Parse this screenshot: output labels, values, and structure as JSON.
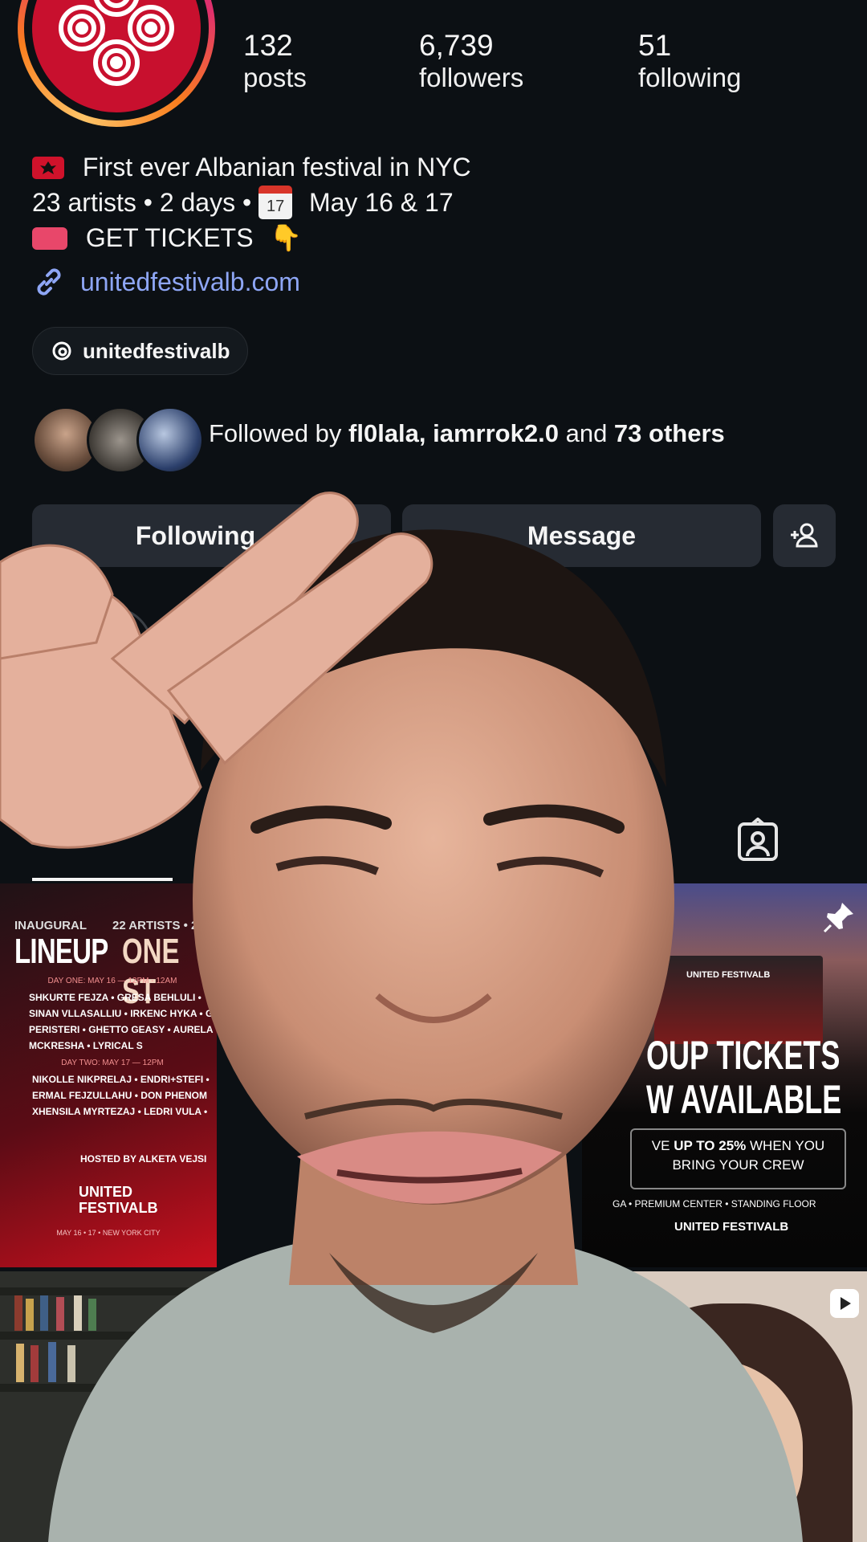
{
  "profile": {
    "stats": [
      {
        "value": "132",
        "label": "posts"
      },
      {
        "value": "6,739",
        "label": "followers"
      },
      {
        "value": "51",
        "label": "following"
      }
    ],
    "bio_line1": "First ever Albanian festival in NYC",
    "bio_line2_a": "23 artists • 2 days •",
    "calendar_emoji_day": "17",
    "bio_line2_b": "May 16 & 17",
    "bio_line3": "GET TICKETS",
    "pointing_emoji": "👇",
    "link": "unitedfestivalb.com",
    "threads_handle": "unitedfestivalb",
    "followed_by_prefix": "Followed by ",
    "followed_by_names": "fl0lala, iamrrok2.0",
    "followed_by_and": " and ",
    "followed_by_others": "73 others",
    "accent_color": "#c8102e",
    "link_color": "#8ea6f5"
  },
  "actions": {
    "following_label": "Following",
    "message_label": "Message"
  },
  "posts": {
    "lineup": {
      "title_left": "LINEUP",
      "title_right": "ONE ST",
      "inaugural": "INAUGURAL",
      "artists_count": "22 ARTISTS • 2",
      "day_one": "DAY ONE: MAY 16 — 12PM - 12AM",
      "day_one_lines": [
        "SHKURTE FEJZA • GRESA BEHLULI •",
        "SINAN VLLASALLIU • IRKENC HYKA • G",
        "PERISTERI • GHETTO GEASY • AURELA",
        "MCKRESHA • LYRICAL S"
      ],
      "day_two": "DAY TWO: MAY 17 — 12PM",
      "day_two_lines": [
        "NIKOLLE NIKPRELAJ • ENDRI+STEFI •",
        "ERMAL FEJZULLAHU • DON PHENOM",
        "XHENSILA MYRTEZAJ • LEDRI VULA •"
      ],
      "hosted_by": "HOSTED BY ALKETA VEJSI",
      "brand": "UNITED FESTIVALB",
      "footer": "MAY 16 • 17 • NEW YORK CITY"
    },
    "tickets": {
      "line1": "OUP TICKETS",
      "line2": "W AVAILABLE",
      "save_a": "VE ",
      "save_b": "UP TO 25%",
      "save_c": " WHEN YOU",
      "save_d": "BRING YOUR CREW",
      "tiers": "GA • PREMIUM CENTER • STANDING FLOOR",
      "brand": "UNITED FESTIVALB",
      "stage_brand": "UNITED FESTIVALB"
    }
  }
}
